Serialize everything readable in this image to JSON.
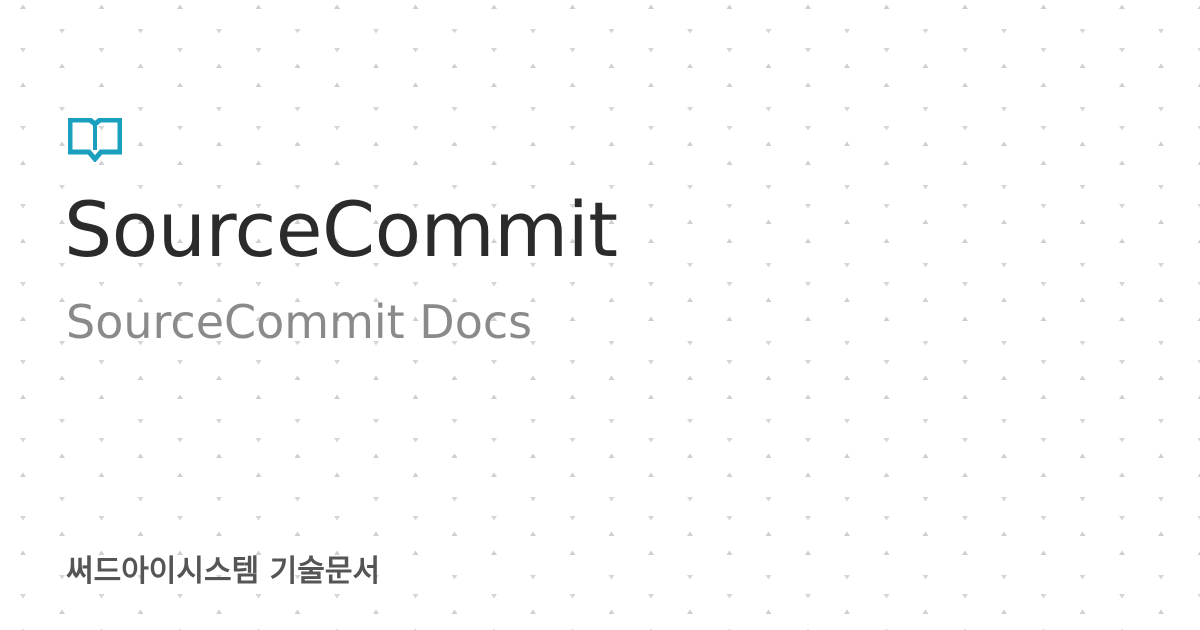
{
  "card": {
    "title": "SourceCommit",
    "subtitle": "SourceCommit Docs",
    "footer": "써드아이시스템 기술문서"
  },
  "logo": {
    "icon": "open-book-icon",
    "color": "#1a9fbf"
  },
  "colors": {
    "background": "#ffffff",
    "title": "#2b2b2b",
    "subtitle": "#8a8a8a",
    "footer": "#555555",
    "pattern_dot": "#c9c9c9"
  }
}
